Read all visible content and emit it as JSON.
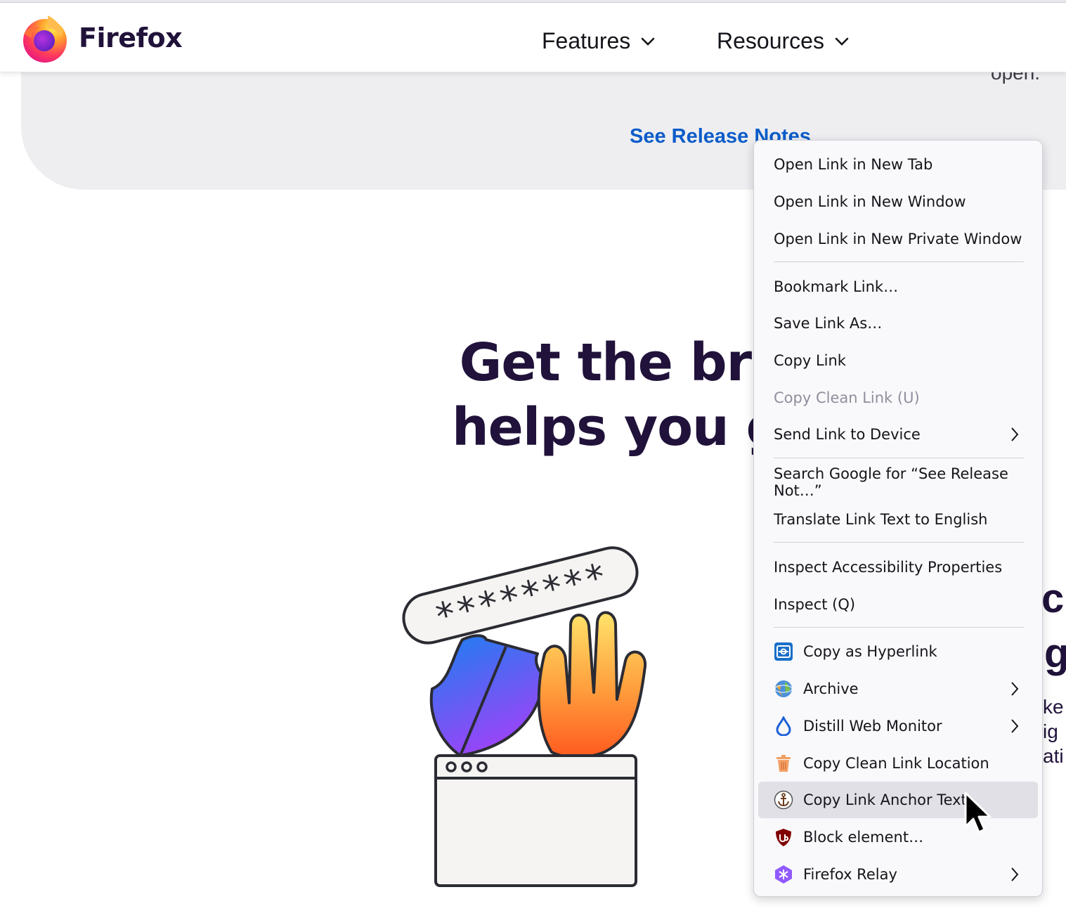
{
  "nav": {
    "brand": "Firefox",
    "features_label": "Features",
    "resources_label": "Resources"
  },
  "page": {
    "open_text": "open.",
    "release_link": "See Release Notes",
    "headline_line1": "Get the brow",
    "headline_line2": "helps you get",
    "password_mask": "********",
    "right_fragments": [
      "ck",
      "g",
      "ke",
      "ig",
      "ati"
    ]
  },
  "context_menu": {
    "items": [
      {
        "label": "Open Link in New Tab"
      },
      {
        "label": "Open Link in New Window"
      },
      {
        "label": "Open Link in New Private Window"
      },
      {
        "label": "Bookmark Link…"
      },
      {
        "label": "Save Link As…"
      },
      {
        "label": "Copy Link"
      },
      {
        "label": "Copy Clean Link (U)",
        "disabled": true
      },
      {
        "label": "Send Link to Device",
        "submenu": true
      },
      {
        "label": "Search Google for “See Release Not…”"
      },
      {
        "label": "Translate Link Text to English"
      },
      {
        "label": "Inspect Accessibility Properties"
      },
      {
        "label": "Inspect (Q)"
      },
      {
        "label": "Copy as Hyperlink",
        "icon": "copy-hyperlink-icon"
      },
      {
        "label": "Archive",
        "icon": "archive-globe-icon",
        "submenu": true
      },
      {
        "label": "Distill Web Monitor",
        "icon": "distill-drop-icon",
        "submenu": true
      },
      {
        "label": "Copy Clean Link Location",
        "icon": "clean-link-trash-icon"
      },
      {
        "label": "Copy Link Anchor Text",
        "icon": "anchor-icon",
        "hovered": true
      },
      {
        "label": "Block element…",
        "icon": "ublock-shield-icon"
      },
      {
        "label": "Firefox Relay",
        "icon": "relay-icon",
        "submenu": true
      }
    ]
  },
  "colors": {
    "brand_text": "#20123a",
    "link_blue": "#0b5cc9",
    "band_gray": "#eeeef1",
    "menu_bg": "#f9f9fb",
    "menu_hover": "#e0e0e6"
  }
}
